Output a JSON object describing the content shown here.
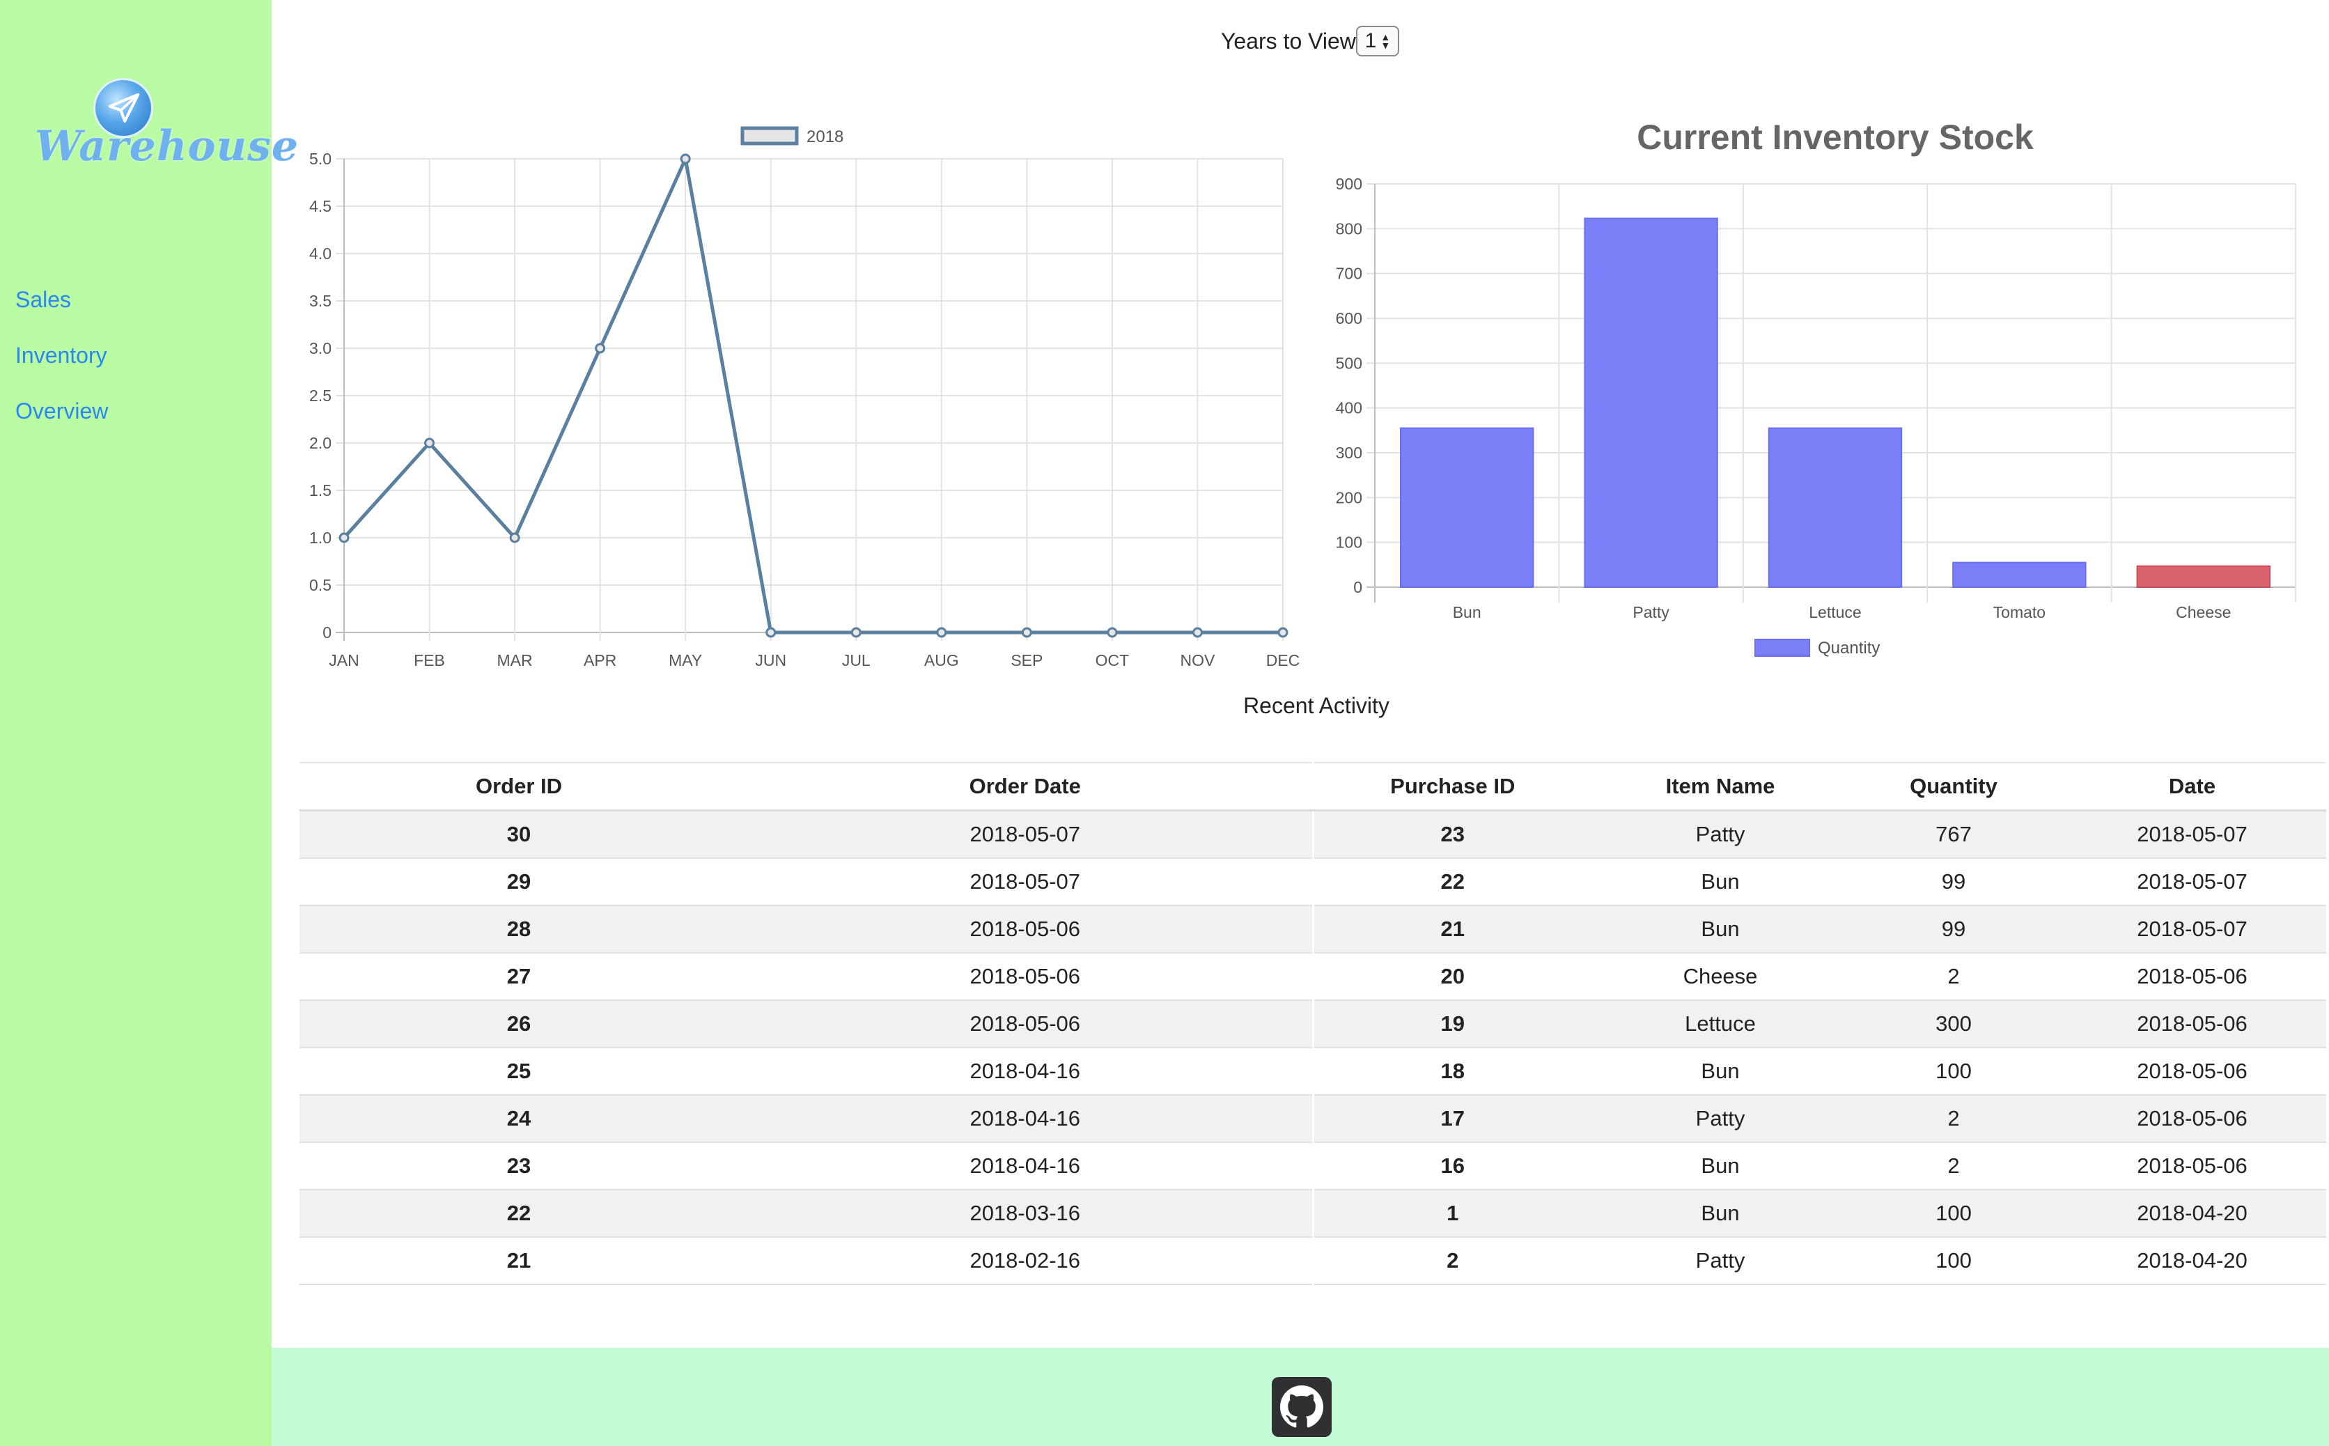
{
  "app": {
    "logo_text": "Warehouse",
    "accent": "#2a86f0",
    "sidebar_bg": "#b8fba3",
    "footer_bg": "#c3fcd7"
  },
  "nav": [
    {
      "label": "Sales"
    },
    {
      "label": "Inventory"
    },
    {
      "label": "Overview"
    }
  ],
  "years": {
    "label": "Years to View",
    "value": "1"
  },
  "chart_data": [
    {
      "type": "line",
      "title": "",
      "categories": [
        "JAN",
        "FEB",
        "MAR",
        "APR",
        "MAY",
        "JUN",
        "JUL",
        "AUG",
        "SEP",
        "OCT",
        "NOV",
        "DEC"
      ],
      "series": [
        {
          "name": "2018",
          "values": [
            1,
            2,
            1,
            3,
            5,
            0,
            0,
            0,
            0,
            0,
            0,
            0
          ],
          "color": "#5b7f9e"
        }
      ],
      "yticks": [
        "0",
        "0.5",
        "1.0",
        "1.5",
        "2.0",
        "2.5",
        "3.0",
        "3.5",
        "4.0",
        "4.5",
        "5.0"
      ],
      "ylim": [
        0,
        5
      ],
      "grid": true,
      "legend": "top"
    },
    {
      "type": "bar",
      "title": "Current Inventory Stock",
      "categories": [
        "Bun",
        "Patty",
        "Lettuce",
        "Tomato",
        "Cheese"
      ],
      "series": [
        {
          "name": "Quantity",
          "values": [
            355,
            823,
            355,
            55,
            47
          ]
        }
      ],
      "bar_colors": [
        "#7b7ff8",
        "#7b7ff8",
        "#7b7ff8",
        "#7b7ff8",
        "#d9636f"
      ],
      "yticks": [
        "0",
        "100",
        "200",
        "300",
        "400",
        "500",
        "600",
        "700",
        "800",
        "900"
      ],
      "ylim": [
        0,
        900
      ],
      "grid": true,
      "legend": "bottom"
    }
  ],
  "activity": {
    "title": "Recent Activity",
    "columns": [
      "Order ID",
      "Order Date",
      "Purchase ID",
      "Item Name",
      "Quantity",
      "Date"
    ],
    "rows": [
      [
        "30",
        "2018-05-07",
        "23",
        "Patty",
        "767",
        "2018-05-07"
      ],
      [
        "29",
        "2018-05-07",
        "22",
        "Bun",
        "99",
        "2018-05-07"
      ],
      [
        "28",
        "2018-05-06",
        "21",
        "Bun",
        "99",
        "2018-05-07"
      ],
      [
        "27",
        "2018-05-06",
        "20",
        "Cheese",
        "2",
        "2018-05-06"
      ],
      [
        "26",
        "2018-05-06",
        "19",
        "Lettuce",
        "300",
        "2018-05-06"
      ],
      [
        "25",
        "2018-04-16",
        "18",
        "Bun",
        "100",
        "2018-05-06"
      ],
      [
        "24",
        "2018-04-16",
        "17",
        "Patty",
        "2",
        "2018-05-06"
      ],
      [
        "23",
        "2018-04-16",
        "16",
        "Bun",
        "2",
        "2018-05-06"
      ],
      [
        "22",
        "2018-03-16",
        "1",
        "Bun",
        "100",
        "2018-04-20"
      ],
      [
        "21",
        "2018-02-16",
        "2",
        "Patty",
        "100",
        "2018-04-20"
      ]
    ]
  },
  "footer": {
    "icon": "github-icon"
  }
}
